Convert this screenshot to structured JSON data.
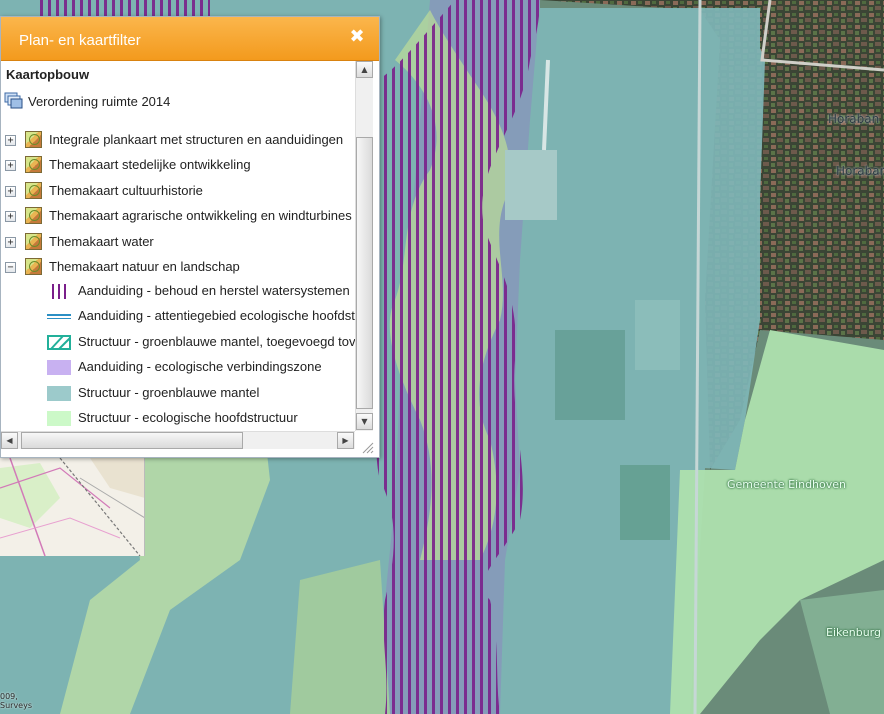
{
  "panel": {
    "title": "Plan- en kaartfilter",
    "close_glyph": "✖",
    "section_title": "Kaartopbouw",
    "root_item": {
      "label": "Verordening ruimte 2014",
      "icon": "layers-icon"
    },
    "groups": [
      {
        "label": "Integrale plankaart met structuren en aanduidingen",
        "expander": "+",
        "expanded": false
      },
      {
        "label": "Themakaart stedelijke ontwikkeling",
        "expander": "+",
        "expanded": false
      },
      {
        "label": "Themakaart cultuurhistorie",
        "expander": "+",
        "expanded": false
      },
      {
        "label": "Themakaart agrarische ontwikkeling en windturbines",
        "expander": "+",
        "expanded": false
      },
      {
        "label": "Themakaart water",
        "expander": "+",
        "expanded": false
      },
      {
        "label": "Themakaart natuur en landschap",
        "expander": "−",
        "expanded": true
      }
    ],
    "legend": [
      {
        "label": "Aanduiding - behoud en herstel watersystemen",
        "swatch": "purple-vertical-hatch",
        "color": "#7a1f8a"
      },
      {
        "label": "Aanduiding - attentiegebied ecologische hoofdst",
        "swatch": "double-blue-line",
        "color": "#2b8fc4"
      },
      {
        "label": "Structuur - groenblauwe mantel, toegevoegd tov",
        "swatch": "teal-diagonal-hatch",
        "color": "#22b09a"
      },
      {
        "label": "Aanduiding - ecologische verbindingszone",
        "swatch": "fill",
        "color": "#c8b1f1"
      },
      {
        "label": "Structuur - groenblauwe mantel",
        "swatch": "fill",
        "color": "#9ccacb"
      },
      {
        "label": "Structuur - ecologische hoofdstructuur",
        "swatch": "fill",
        "color": "#ccf9c8"
      }
    ]
  },
  "map": {
    "labels": {
      "gemeente": "Gemeente Eindhoven",
      "eikenburg": "Eikenburg",
      "horaban": "Horaban",
      "horaban_2": "Horaban"
    },
    "copyright": "009,\nSurveys"
  },
  "colors": {
    "header_orange": "#f6a22c",
    "mantel": "#9ccacb",
    "ehs_green": "#ccf9c8",
    "verbindingszone": "#c8b1f1",
    "watersystemen": "#7a1f8a"
  }
}
